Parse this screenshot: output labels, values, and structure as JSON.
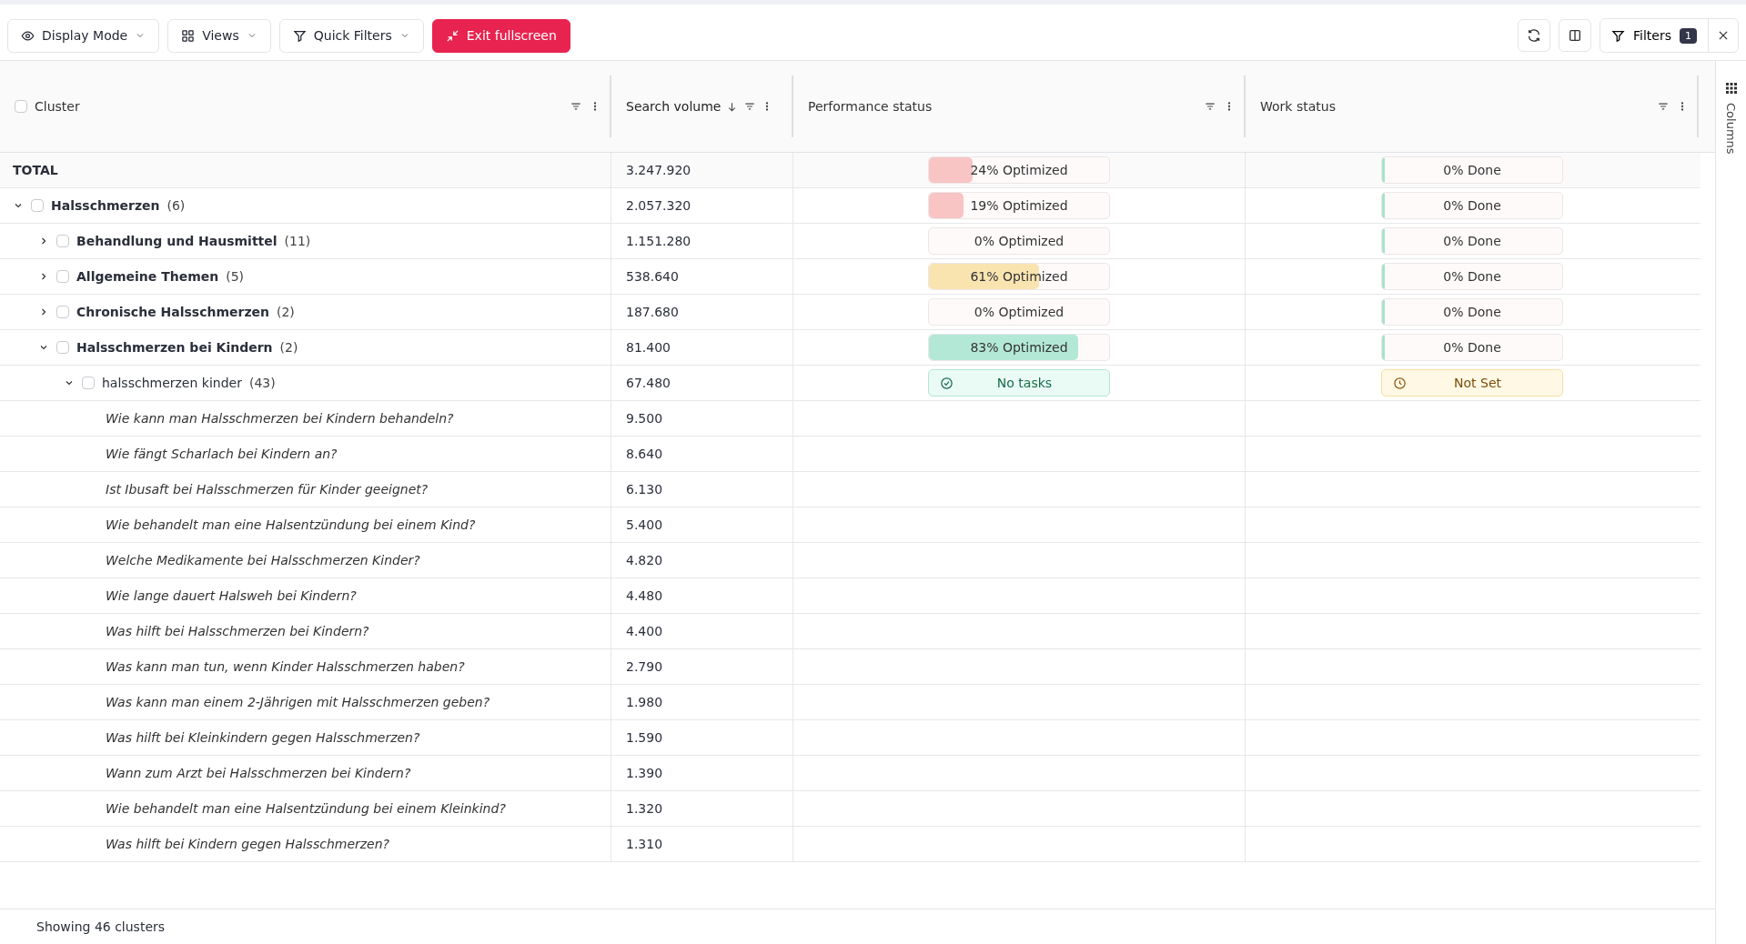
{
  "toolbar": {
    "left": [
      {
        "label": "Display Mode",
        "kind": "dropdown"
      },
      {
        "label": "Views",
        "kind": "dropdown"
      },
      {
        "label": "Quick Filters",
        "kind": "dropdown"
      },
      {
        "label": "Exit fullscreen",
        "kind": "primary"
      }
    ],
    "filters": {
      "label": "Filters",
      "count": "1"
    }
  },
  "select_all": {
    "checked": false
  },
  "columns": [
    {
      "label": "Cluster",
      "sorted": false
    },
    {
      "label": "Search volume",
      "sorted": true
    },
    {
      "label": "Performance status",
      "sorted": false
    },
    {
      "label": "Work status",
      "sorted": false
    }
  ],
  "side_panel": {
    "label": "Columns"
  },
  "total": {
    "kind": "total",
    "name": "TOTAL",
    "volume": "3.247.920",
    "performance": {
      "kind": "progress",
      "label": "24% Optimized",
      "level": 0.24,
      "color": "#f8c4c4"
    },
    "work": {
      "kind": "progress",
      "label": "0% Done",
      "level": 0
    }
  },
  "rows": [
    {
      "kind": "group",
      "name": "Halsschmerzen",
      "count": "(6)",
      "volume": "2.057.320",
      "expanded": true,
      "checked": false,
      "performance": {
        "kind": "progress",
        "label": "19% Optimized",
        "level": 0.19,
        "color": "#f8c4c4"
      },
      "work": {
        "kind": "progress",
        "label": "0% Done",
        "level": 0
      },
      "children": [
        {
          "kind": "group",
          "name": "Behandlung und Hausmittel",
          "count": "(11)",
          "volume": "1.151.280",
          "expanded": false,
          "checked": false,
          "performance": {
            "kind": "progress",
            "label": "0% Optimized"
          },
          "work": {
            "kind": "progress",
            "label": "0% Done",
            "level": 0
          }
        },
        {
          "kind": "group",
          "name": "Allgemeine Themen",
          "count": "(5)",
          "volume": "538.640",
          "expanded": false,
          "checked": false,
          "performance": {
            "kind": "progress",
            "label": "61% Optimized",
            "level": 0.61,
            "color": "#f9e4b0"
          },
          "work": {
            "kind": "progress",
            "label": "0% Done",
            "level": 0
          }
        },
        {
          "kind": "group",
          "name": "Chronische Halsschmerzen",
          "count": "(2)",
          "volume": "187.680",
          "expanded": false,
          "checked": false,
          "performance": {
            "kind": "progress",
            "label": "0% Optimized"
          },
          "work": {
            "kind": "progress",
            "label": "0% Done",
            "level": 0
          }
        },
        {
          "kind": "group",
          "name": "Halsschmerzen bei Kindern",
          "count": "(2)",
          "volume": "81.400",
          "expanded": true,
          "checked": false,
          "performance": {
            "kind": "progress",
            "label": "83% Optimized",
            "level": 0.83,
            "color": "#b3e8d6"
          },
          "work": {
            "kind": "progress",
            "label": "0% Done",
            "level": 0
          },
          "children": [
            {
              "kind": "cluster",
              "name": "halsschmerzen kinder",
              "count": "(43)",
              "volume": "67.480",
              "expanded": true,
              "checked": false,
              "performance": {
                "kind": "tasks",
                "label": "No tasks"
              },
              "work": {
                "kind": "notset",
                "label": "Not Set"
              },
              "children": [
                {
                  "kind": "keyword",
                  "name": "Wie kann man Halsschmerzen bei Kindern behandeln?",
                  "volume": "9.500"
                },
                {
                  "kind": "keyword",
                  "name": "Wie fängt Scharlach bei Kindern an?",
                  "volume": "8.640"
                },
                {
                  "kind": "keyword",
                  "name": "Ist Ibusaft bei Halsschmerzen für Kinder geeignet?",
                  "volume": "6.130"
                },
                {
                  "kind": "keyword",
                  "name": "Wie behandelt man eine Halsentzündung bei einem Kind?",
                  "volume": "5.400"
                },
                {
                  "kind": "keyword",
                  "name": "Welche Medikamente bei Halsschmerzen Kinder?",
                  "volume": "4.820"
                },
                {
                  "kind": "keyword",
                  "name": "Wie lange dauert Halsweh bei Kindern?",
                  "volume": "4.480"
                },
                {
                  "kind": "keyword",
                  "name": "Was hilft bei Halsschmerzen bei Kindern?",
                  "volume": "4.400"
                },
                {
                  "kind": "keyword",
                  "name": "Was kann man tun, wenn Kinder Halsschmerzen haben?",
                  "volume": "2.790"
                },
                {
                  "kind": "keyword",
                  "name": "Was kann man einem 2-Jährigen mit Halsschmerzen geben?",
                  "volume": "1.980"
                },
                {
                  "kind": "keyword",
                  "name": "Was hilft bei Kleinkindern gegen Halsschmerzen?",
                  "volume": "1.590"
                },
                {
                  "kind": "keyword",
                  "name": "Wann zum Arzt bei Halsschmerzen bei Kindern?",
                  "volume": "1.390"
                },
                {
                  "kind": "keyword",
                  "name": "Wie behandelt man eine Halsentzündung bei einem Kleinkind?",
                  "volume": "1.320"
                },
                {
                  "kind": "keyword",
                  "name": "Was hilft bei Kindern gegen Halsschmerzen?",
                  "volume": "1.310"
                }
              ]
            }
          ]
        }
      ]
    }
  ],
  "footer": "Showing 46 clusters"
}
